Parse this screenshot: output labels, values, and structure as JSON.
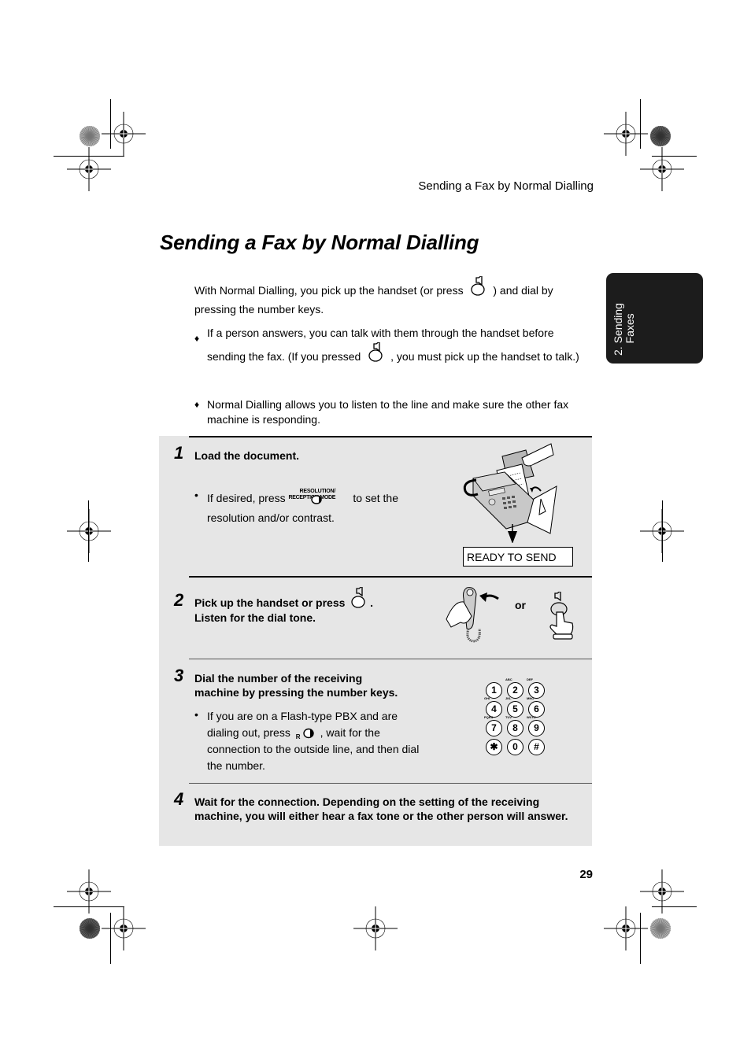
{
  "header": {
    "running_head": "Sending a Fax by Normal Dialling"
  },
  "title": "Sending a Fax by Normal Dialling",
  "side_tab": {
    "label": "2. Sending\n    Faxes",
    "color": "#1c1c1c"
  },
  "intro": {
    "text_before": "With Normal Dialling, you pick up the handset (or press",
    "text_after": ") and dial by pressing the number keys.",
    "key_icon": "speaker-button-icon"
  },
  "bullets": [
    {
      "marker": "♦",
      "text_before": "If a person answers, you can talk with them through the handset before sending the fax. (If you pressed",
      "text_after": ", you must pick up the handset to talk.)"
    },
    {
      "marker": "♦",
      "text": "Normal Dialling allows you to listen to the line and make sure the other fax machine is responding."
    }
  ],
  "steps": [
    {
      "number": "1",
      "text": "Load the document.",
      "sub": {
        "marker": "•",
        "text_before": "If desired, press",
        "key_label_line1": "RESOLUTION/",
        "key_label_line2": "RECEPTION MODE",
        "text_after": "to set the resolution and/or contrast."
      },
      "display": "READY TO SEND",
      "illustration": "fax-machine-loading-document"
    },
    {
      "number": "2",
      "text_line1": "Pick up the handset or press",
      "text_line1_end": ".",
      "text_line2": "Listen for the dial tone.",
      "or_label": "or",
      "illustration": "handset-lift-or-speaker-press"
    },
    {
      "number": "3",
      "text_line1": "Dial the number of the receiving",
      "text_line2": "machine by pressing the number keys.",
      "sub": {
        "marker": "•",
        "text_before": "If you are on a Flash-type PBX and are dialing out, press",
        "key_label": "R",
        "text_after": ", wait for the connection to the outside line, and then dial the number."
      },
      "keypad": [
        {
          "key": "1",
          "letters": ""
        },
        {
          "key": "2",
          "letters": "ABC"
        },
        {
          "key": "3",
          "letters": "DEF"
        },
        {
          "key": "4",
          "letters": "GHI"
        },
        {
          "key": "5",
          "letters": "JKL"
        },
        {
          "key": "6",
          "letters": "MNO"
        },
        {
          "key": "7",
          "letters": "PQRS"
        },
        {
          "key": "8",
          "letters": "TUV"
        },
        {
          "key": "9",
          "letters": "WXYZ"
        },
        {
          "key": "✱",
          "letters": ""
        },
        {
          "key": "0",
          "letters": ""
        },
        {
          "key": "#",
          "letters": ""
        }
      ]
    },
    {
      "number": "4",
      "text_line1": "Wait for the connection. Depending on the setting of the receiving",
      "text_line2": "machine, you will either hear a fax tone or the other person will answer."
    }
  ],
  "page_number": "29",
  "colors": {
    "steps_background": "#e6e6e6",
    "text": "#000000"
  }
}
